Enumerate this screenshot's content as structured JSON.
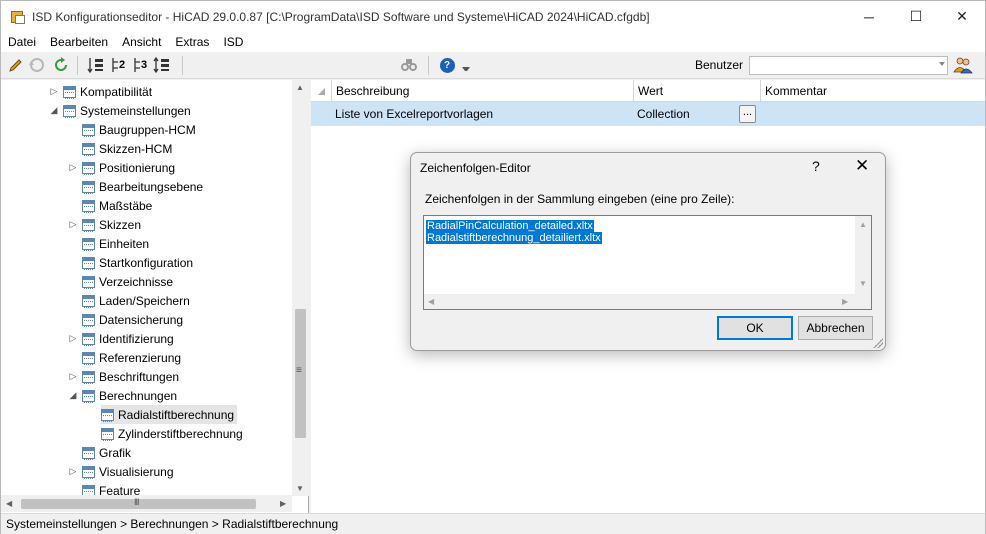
{
  "window": {
    "title": "ISD Konfigurationseditor  -  HiCAD 29.0.0.87 [C:\\ProgramData\\ISD Software und Systeme\\HiCAD 2024\\HiCAD.cfgdb]"
  },
  "window_controls": {
    "minimize": "─",
    "maximize": "☐",
    "close": "✕"
  },
  "menu": [
    "Datei",
    "Bearbeiten",
    "Ansicht",
    "Extras",
    "ISD"
  ],
  "toolbar": {
    "user_label": "Benutzer",
    "user_value": "",
    "icons": [
      "pencil-icon",
      "undo-icon",
      "refresh-icon",
      "sort-icon",
      "level2-icon",
      "level3-icon",
      "expand-icon",
      "find-icon",
      "help-icon",
      "users-icon"
    ],
    "glyphs": {
      "level2": "2",
      "level3": "3",
      "help": "?"
    }
  },
  "tree": {
    "items": [
      {
        "label": "Kompatibilität",
        "exp": "▷"
      },
      {
        "label": "Systemeinstellungen",
        "exp": "◢"
      },
      {
        "label": "Baugruppen-HCM",
        "exp": ""
      },
      {
        "label": "Skizzen-HCM",
        "exp": ""
      },
      {
        "label": "Positionierung",
        "exp": "▷"
      },
      {
        "label": "Bearbeitungsebene",
        "exp": ""
      },
      {
        "label": "Maßstäbe",
        "exp": ""
      },
      {
        "label": "Skizzen",
        "exp": "▷"
      },
      {
        "label": "Einheiten",
        "exp": ""
      },
      {
        "label": "Startkonfiguration",
        "exp": ""
      },
      {
        "label": "Verzeichnisse",
        "exp": ""
      },
      {
        "label": "Laden/Speichern",
        "exp": ""
      },
      {
        "label": "Datensicherung",
        "exp": ""
      },
      {
        "label": "Identifizierung",
        "exp": "▷"
      },
      {
        "label": "Referenzierung",
        "exp": ""
      },
      {
        "label": "Beschriftungen",
        "exp": "▷"
      },
      {
        "label": "Berechnungen",
        "exp": "◢"
      },
      {
        "label": "Radialstiftberechnung",
        "exp": "",
        "selected": true
      },
      {
        "label": "Zylinderstiftberechnung",
        "exp": ""
      },
      {
        "label": "Grafik",
        "exp": ""
      },
      {
        "label": "Visualisierung",
        "exp": "▷"
      },
      {
        "label": "Feature",
        "exp": ""
      }
    ],
    "scroll": {
      "up": "▲",
      "down": "▼",
      "left": "◀",
      "right": "▶",
      "grip_v": "≡",
      "grip_h": "III"
    }
  },
  "grid": {
    "headers": [
      "Beschreibung",
      "Wert",
      "Kommentar"
    ],
    "rows": [
      {
        "description": "Liste von Excelreportvorlagen",
        "value": "Collection",
        "comment": "",
        "button": "..."
      }
    ]
  },
  "status": {
    "path": "Systemeinstellungen > Berechnungen > Radialstiftberechnung"
  },
  "dialog": {
    "title": "Zeichenfolgen-Editor",
    "help": "?",
    "close": "✕",
    "prompt": "Zeichenfolgen in der Sammlung eingeben (eine pro Zeile):",
    "lines": [
      "RadialPinCalculation_detailed.xltx",
      "Radialstiftberechnung_detailiert.xltx"
    ],
    "ok": "OK",
    "cancel": "Abbrechen",
    "scroll": {
      "up": "▲",
      "down": "▼",
      "left": "◀",
      "right": "▶"
    }
  },
  "colors": {
    "accent": "#0078d7",
    "selected_row": "#cde4f7",
    "tree_selected": "#e5e5e5"
  }
}
